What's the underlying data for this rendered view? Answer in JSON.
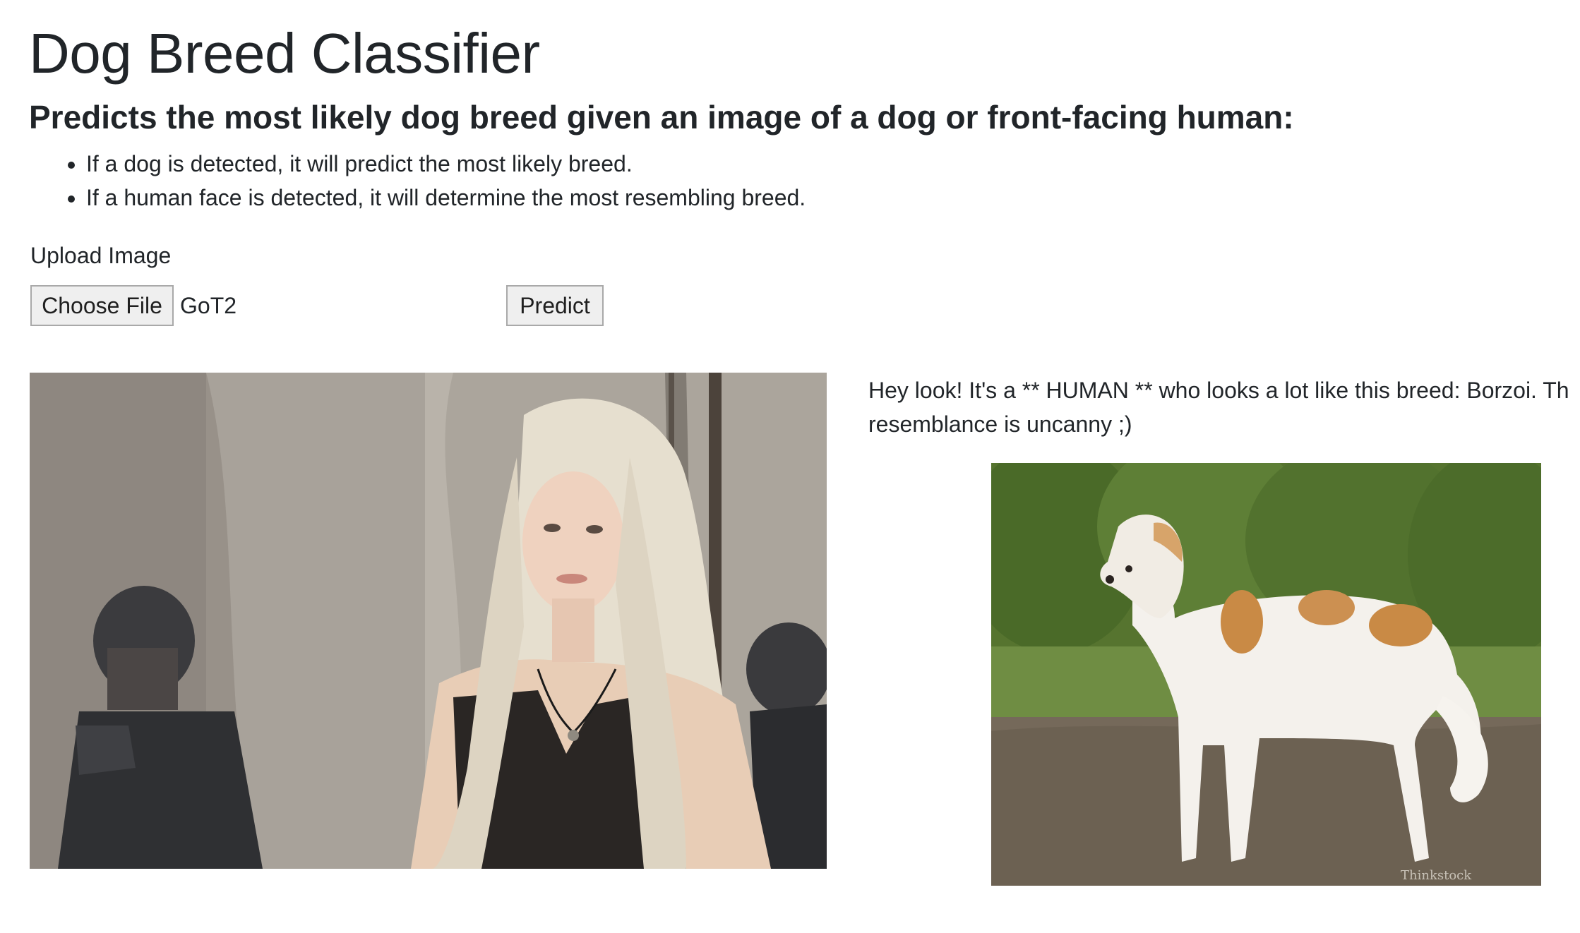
{
  "header": {
    "title": "Dog Breed Classifier",
    "subtitle": "Predicts the most likely dog breed given an image of a dog or front-facing human:"
  },
  "bullets": [
    "If a dog is detected, it will predict the most likely breed.",
    "If a human face is detected, it will determine the most resembling breed."
  ],
  "upload": {
    "label": "Upload Image",
    "choose_file_label": "Choose File",
    "file_name": "GoT2",
    "predict_label": "Predict"
  },
  "result": {
    "line1": "Hey look! It's a ** HUMAN ** who looks a lot like this breed: Borzoi. Th",
    "line2": "resemblance is uncanny ;)",
    "uploaded_image_alt": "woman with long platinum blonde braided hair in front of a stone wall with helmeted soldiers",
    "breed_image_alt": "Borzoi dog standing on dirt in front of green trees",
    "watermark": "Thinkstock"
  },
  "colors": {
    "text": "#212529",
    "button_bg": "#efefef",
    "button_border": "#a9a9a9",
    "page_bg": "#ffffff"
  }
}
